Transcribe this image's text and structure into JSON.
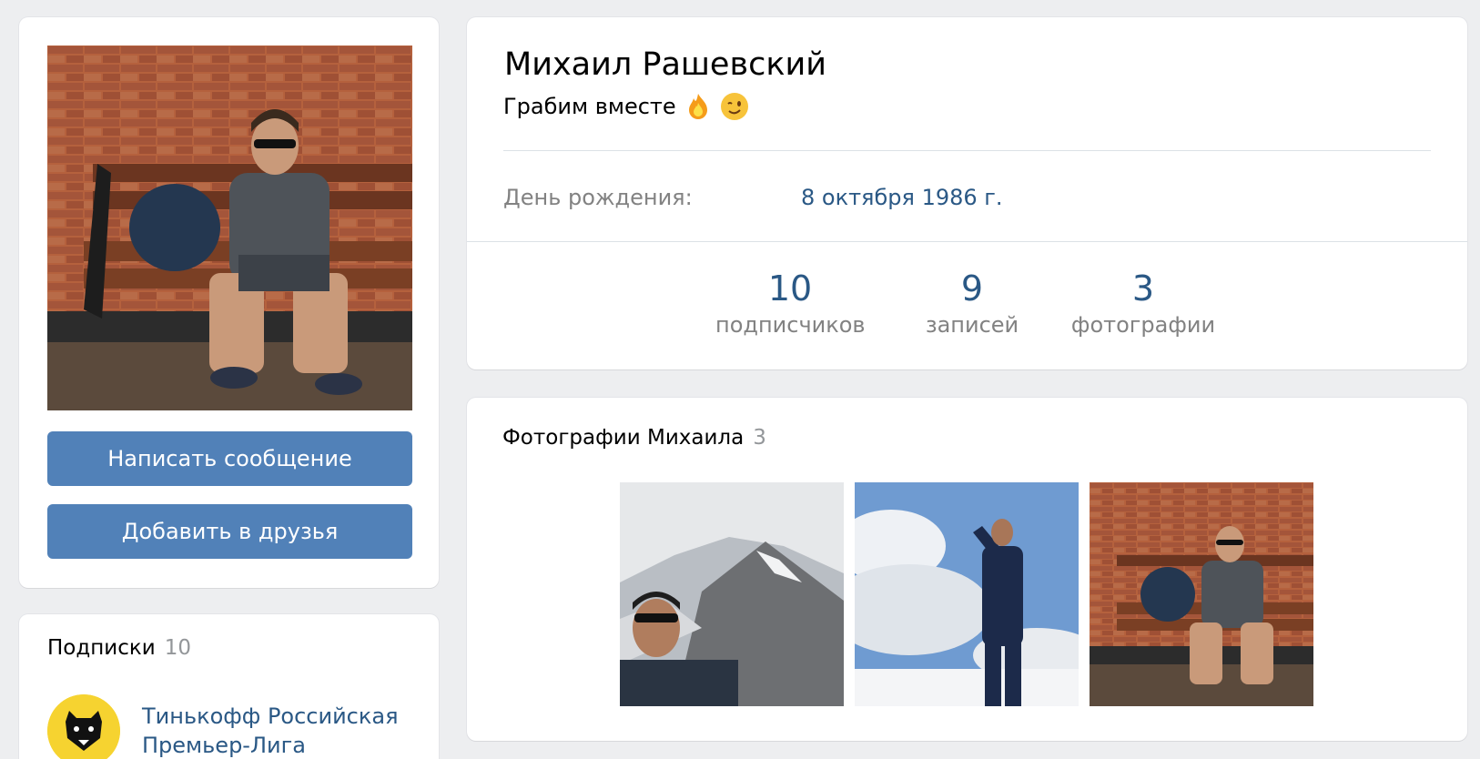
{
  "profile": {
    "name": "Михаил Рашевский",
    "status": "Грабим вместе",
    "status_emoji": [
      "fire-emoji",
      "wink-emoji"
    ],
    "birthday_label": "День рождения:",
    "birthday_value": "8 октября 1986 г."
  },
  "actions": {
    "message_label": "Написать сообщение",
    "add_friend_label": "Добавить в друзья"
  },
  "stats": [
    {
      "value": "10",
      "label": "подписчиков"
    },
    {
      "value": "9",
      "label": "записей"
    },
    {
      "value": "3",
      "label": "фотографии"
    }
  ],
  "photos": {
    "title": "Фотографии Михаила",
    "count": "3"
  },
  "subscriptions": {
    "title": "Подписки",
    "count": "10",
    "items": [
      {
        "name": "Тинькофф Российская Премьер-Лига",
        "icon": "bear-logo-icon"
      }
    ]
  },
  "colors": {
    "background": "#edeef0",
    "button": "#5181b8",
    "link": "#2a5885",
    "muted": "#828282"
  }
}
